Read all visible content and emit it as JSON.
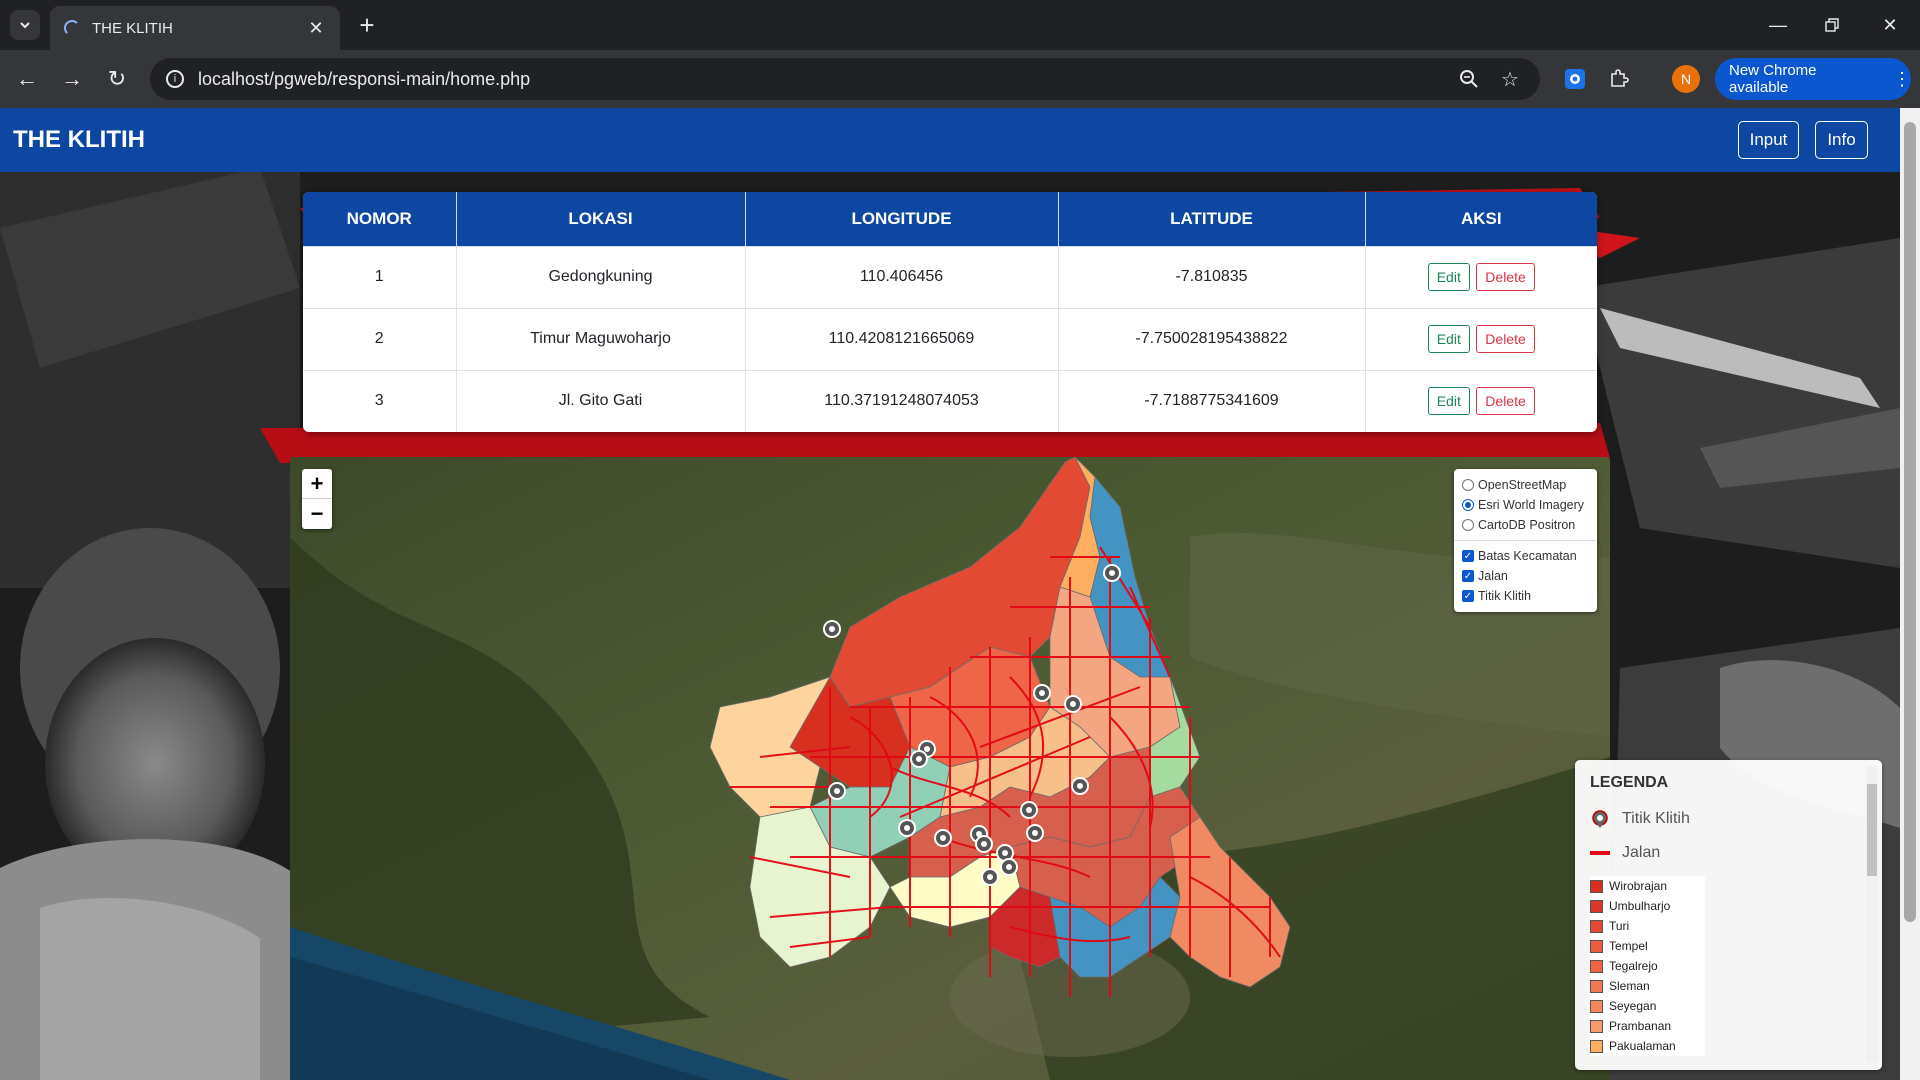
{
  "browser": {
    "tab_title": "THE KLITIH",
    "url": "localhost/pgweb/responsi-main/home.php",
    "profile_initial": "N",
    "update_label": "New Chrome available"
  },
  "app": {
    "brand": "THE KLITIH",
    "nav": {
      "input_label": "Input",
      "info_label": "Info"
    }
  },
  "table": {
    "headers": [
      "NOMOR",
      "LOKASI",
      "LONGITUDE",
      "LATITUDE",
      "AKSI"
    ],
    "rows": [
      {
        "no": "1",
        "lokasi": "Gedongkuning",
        "longitude": "110.406456",
        "latitude": "-7.810835"
      },
      {
        "no": "2",
        "lokasi": "Timur Maguwoharjo",
        "longitude": "110.4208121665069",
        "latitude": "-7.750028195438822"
      },
      {
        "no": "3",
        "lokasi": "Jl. Gito Gati",
        "longitude": "110.37191248074053",
        "latitude": "-7.7188775341609"
      }
    ],
    "edit_label": "Edit",
    "delete_label": "Delete"
  },
  "map": {
    "zoom_in": "+",
    "zoom_out": "−",
    "base_layers": [
      {
        "label": "OpenStreetMap",
        "selected": false
      },
      {
        "label": "Esri World Imagery",
        "selected": true
      },
      {
        "label": "CartoDB Positron",
        "selected": false
      }
    ],
    "overlays": [
      {
        "label": "Batas Kecamatan",
        "checked": true
      },
      {
        "label": "Jalan",
        "checked": true
      },
      {
        "label": "Titik Klitih",
        "checked": true
      }
    ]
  },
  "legend": {
    "title": "LEGENDA",
    "titik_label": "Titik Klitih",
    "jalan_label": "Jalan",
    "jalan_color": "#e30613",
    "kecamatan": [
      {
        "name": "Wirobrajan",
        "color": "#d7301f"
      },
      {
        "name": "Umbulharjo",
        "color": "#d9352a"
      },
      {
        "name": "Turi",
        "color": "#e34a33"
      },
      {
        "name": "Tempel",
        "color": "#e85c3f"
      },
      {
        "name": "Tegalrejo",
        "color": "#ef6548"
      },
      {
        "name": "Sleman",
        "color": "#f07a55"
      },
      {
        "name": "Seyegan",
        "color": "#f4875f"
      },
      {
        "name": "Prambanan",
        "color": "#f89a6a"
      },
      {
        "name": "Pakualaman",
        "color": "#fdae61"
      }
    ]
  }
}
